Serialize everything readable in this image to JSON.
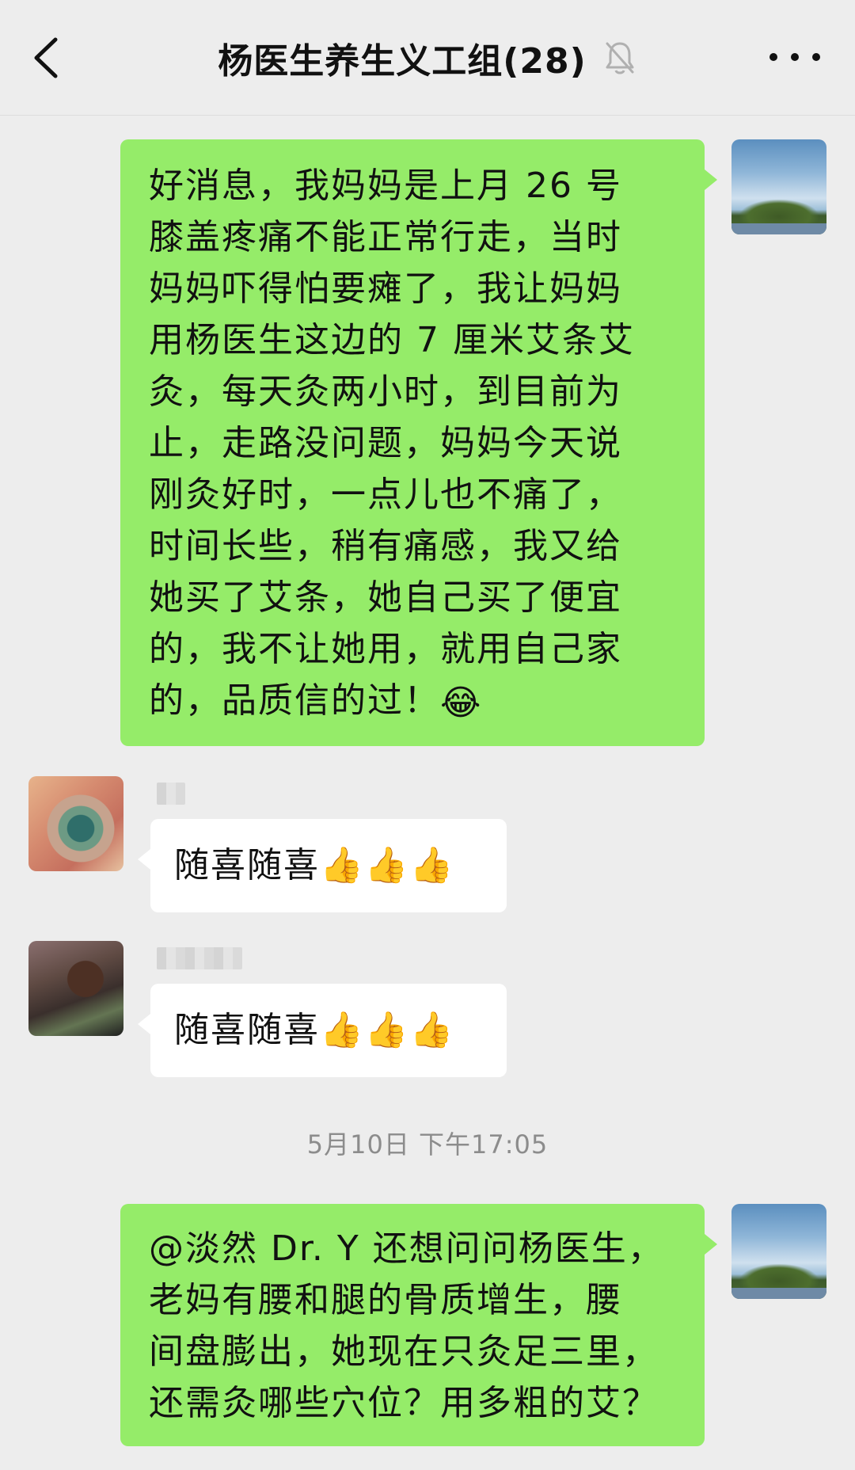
{
  "header": {
    "title": "杨医生养生义工组(28)",
    "back_icon": "chevron-left-icon",
    "mute_icon": "bell-muted-icon",
    "more_icon": "more-dots-icon"
  },
  "messages": [
    {
      "sender": "self",
      "lines": [
        "好消息，我妈妈是上月 26 号",
        "膝盖疼痛不能正常行走，当时",
        "妈妈吓得怕要瘫了，我让妈妈",
        "用杨医生这边的 7 厘米艾条艾",
        "灸，每天灸两小时，到目前为",
        "止，走路没问题，妈妈今天说",
        "刚灸好时，一点儿也不痛了，",
        "时间长些，稍有痛感，我又给",
        "她买了艾条，她自己买了便宜",
        "的，我不让她用，就用自己家",
        "的，品质信的过！"
      ],
      "trailing_emoji": "😂"
    },
    {
      "sender": "member-1",
      "text": "随喜随喜",
      "trailing_emoji": "👍👍👍"
    },
    {
      "sender": "member-2",
      "text": "随喜随喜",
      "trailing_emoji": "👍👍👍"
    },
    {
      "sender": "self",
      "lines": [
        "@淡然 Dr. Y  还想问问杨医生，",
        "老妈有腰和腿的骨质增生，腰",
        "间盘膨出，她现在只灸足三里，",
        "还需灸哪些穴位？用多粗的艾？"
      ]
    }
  ],
  "timestamp": "5月10日 下午17:05",
  "colors": {
    "background": "#ededed",
    "self_bubble": "#95ec69",
    "other_bubble": "#ffffff",
    "timestamp_text": "#8c8c8c"
  }
}
